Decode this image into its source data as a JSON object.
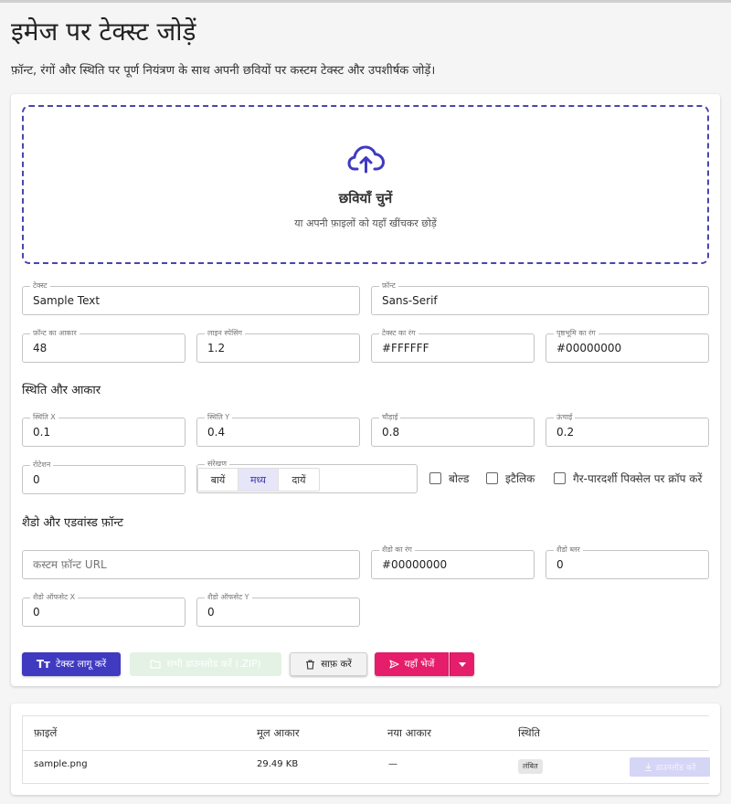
{
  "header": {
    "title": "इमेज पर टेक्स्ट जोड़ें",
    "subtitle": "फ़ॉन्ट, रंगों और स्थिति पर पूर्ण नियंत्रण के साथ अपनी छवियों पर कस्टम टेक्स्ट और उपशीर्षक जोड़ें।"
  },
  "dropzone": {
    "icon": "cloud-upload-icon",
    "title": "छवियाँ चुनें",
    "hint": "या अपनी फ़ाइलों को यहाँ खींचकर छोड़ें"
  },
  "fields": {
    "text": {
      "label": "टेक्स्ट",
      "value": "Sample Text"
    },
    "font": {
      "label": "फ़ॉन्ट",
      "value": "Sans-Serif"
    },
    "font_size": {
      "label": "फ़ॉन्ट का आकार",
      "value": "48"
    },
    "line_spacing": {
      "label": "लाइन स्पेसिंग",
      "value": "1.2"
    },
    "text_color": {
      "label": "टेक्स्ट का रंग",
      "value": "#FFFFFF"
    },
    "bg_color": {
      "label": "पृष्ठभूमि का रंग",
      "value": "#00000000"
    },
    "pos_x": {
      "label": "स्थिति X",
      "value": "0.1"
    },
    "pos_y": {
      "label": "स्थिति Y",
      "value": "0.4"
    },
    "width": {
      "label": "चौड़ाई",
      "value": "0.8"
    },
    "height": {
      "label": "ऊंचाई",
      "value": "0.2"
    },
    "rotation": {
      "label": "रोटेशन",
      "value": "0"
    },
    "custom_font_url": {
      "placeholder": "कस्टम फ़ॉन्ट URL"
    },
    "shadow_color": {
      "label": "शैडो का रंग",
      "value": "#00000000"
    },
    "shadow_blur": {
      "label": "शैडो ब्लर",
      "value": "0"
    },
    "shadow_offset_x": {
      "label": "शैडो ऑफसेट X",
      "value": "0"
    },
    "shadow_offset_y": {
      "label": "शैडो ऑफसेट Y",
      "value": "0"
    }
  },
  "sections": {
    "position_size": "स्थिति और आकार",
    "shadow_advanced": "शैडो और एडवांस्ड फ़ॉन्ट"
  },
  "alignment": {
    "label": "संरेखण",
    "options": [
      "बायें",
      "मध्य",
      "दायें"
    ],
    "selected": "मध्य"
  },
  "checkboxes": {
    "bold": "बोल्ड",
    "italic": "इटैलिक",
    "crop_transparent": "गैर-पारदर्शी पिक्सेल पर क्रॉप करें"
  },
  "buttons": {
    "apply": "टेक्स्ट लागू करें",
    "download_zip": "सभी डाउनलोड करें (.ZIP)",
    "clear": "साफ़ करें",
    "send_here": "यहाँ भेजें"
  },
  "table": {
    "headers": [
      "फ़ाइलें",
      "मूल आकार",
      "नया आकार",
      "स्थिति"
    ],
    "rows": [
      {
        "file": "sample.png",
        "original_size": "29.49 KB",
        "new_size": "—",
        "status": "लंबित",
        "action": "डाउनलोड करें"
      }
    ]
  },
  "colors": {
    "primary": "#3f3ac0",
    "accent": "#e51d6a",
    "dropzone_border": "#4a45b0"
  }
}
